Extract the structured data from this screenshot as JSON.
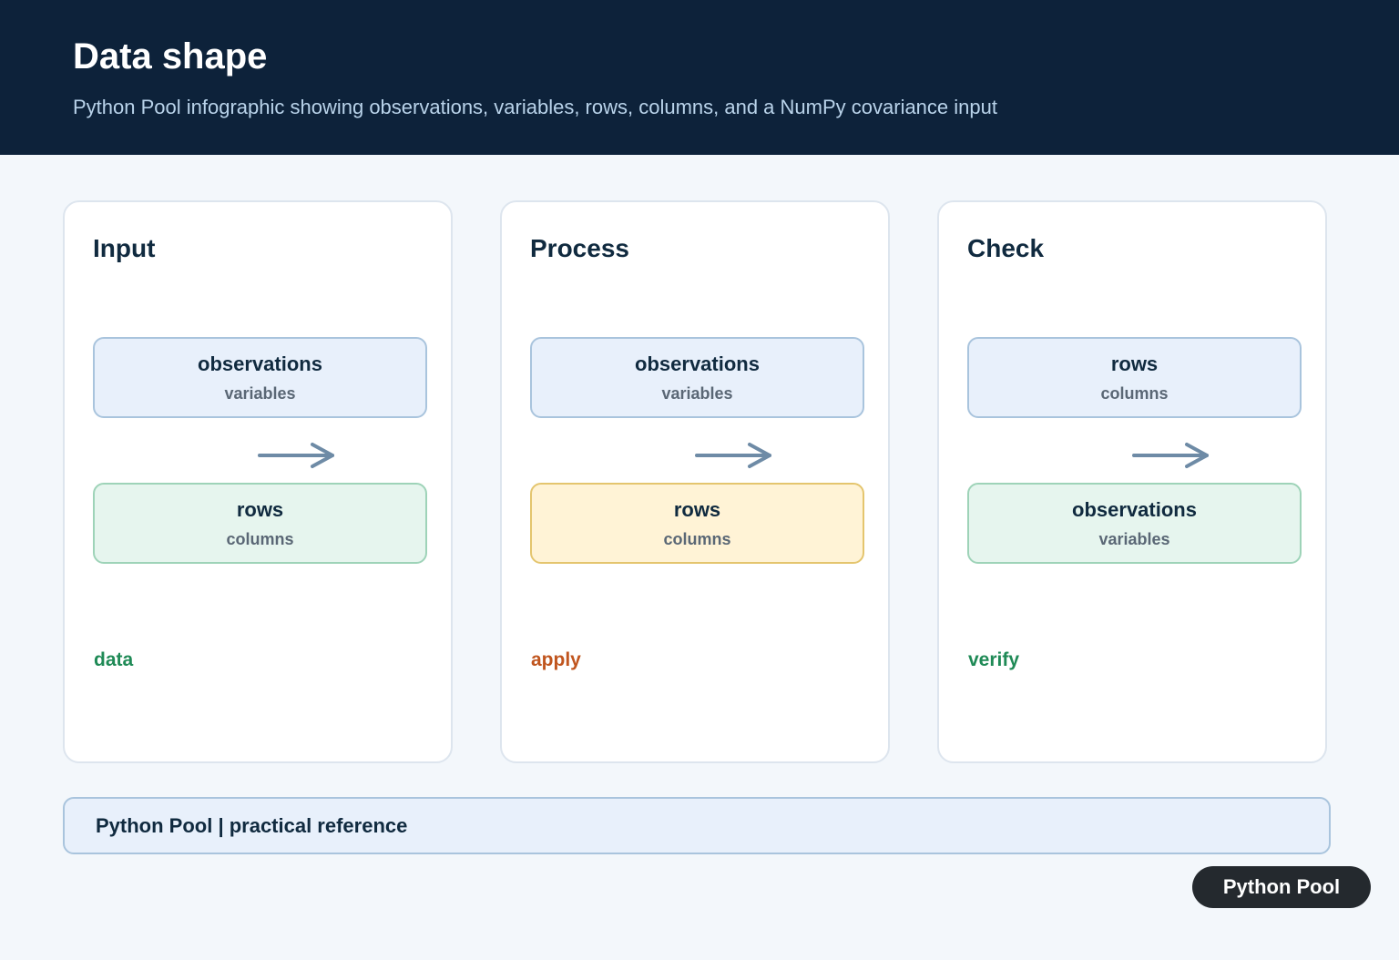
{
  "header": {
    "title": "Data shape",
    "subtitle": "Python Pool infographic showing observations, variables, rows, columns, and a NumPy covariance input"
  },
  "panels": [
    {
      "title": "Input",
      "top_box": {
        "main": "observations",
        "sub": "variables",
        "color": "#e8f0fb"
      },
      "bottom_box": {
        "main": "rows",
        "sub": "columns",
        "color": "#e6f5ee"
      },
      "tag": "data",
      "tag_color": "#1f8a56"
    },
    {
      "title": "Process",
      "top_box": {
        "main": "observations",
        "sub": "variables",
        "color": "#e8f0fb"
      },
      "bottom_box": {
        "main": "rows",
        "sub": "columns",
        "color": "#fff3d6"
      },
      "tag": "apply",
      "tag_color": "#c0551e"
    },
    {
      "title": "Check",
      "top_box": {
        "main": "rows",
        "sub": "columns",
        "color": "#e8f0fb"
      },
      "bottom_box": {
        "main": "observations",
        "sub": "variables",
        "color": "#e6f5ee"
      },
      "tag": "verify",
      "tag_color": "#1f8a56"
    }
  ],
  "footer": {
    "text": "Python Pool | practical reference"
  },
  "brand": {
    "label": "Python Pool"
  },
  "colors": {
    "header_bg": "#0d223a",
    "arrow": "#6e8ba6"
  },
  "icons": {
    "arrow": "arrow-right-icon"
  }
}
